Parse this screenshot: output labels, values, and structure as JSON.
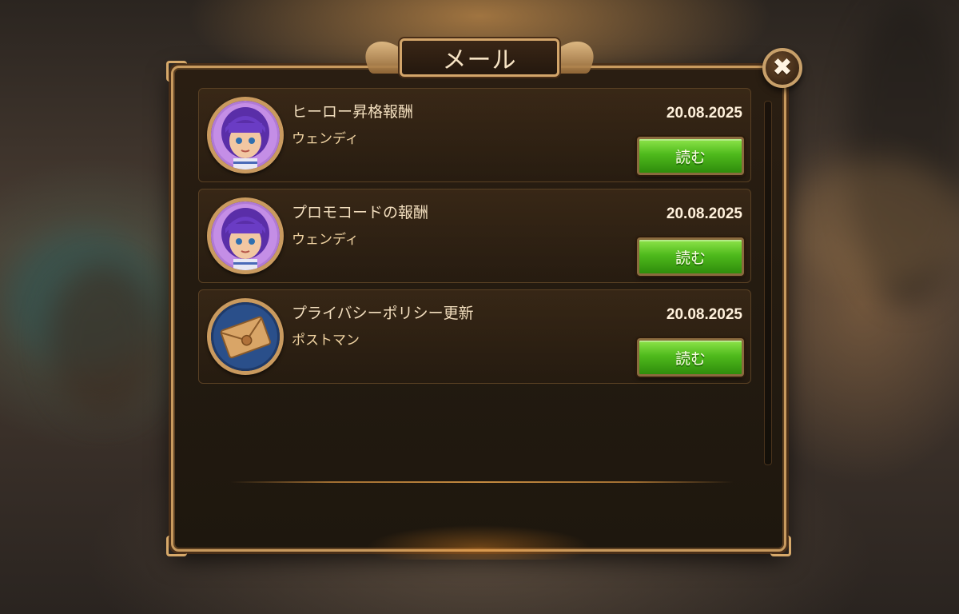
{
  "window": {
    "title": "メール",
    "close_icon": "close-icon"
  },
  "mails": [
    {
      "title": "ヒーロー昇格報酬",
      "sender": "ウェンディ",
      "date": "20.08.2025",
      "button_label": "読む",
      "icon": "hero-avatar-icon"
    },
    {
      "title": "プロモコードの報酬",
      "sender": "ウェンディ",
      "date": "20.08.2025",
      "button_label": "読む",
      "icon": "hero-avatar-icon"
    },
    {
      "title": "プライバシーポリシー更新",
      "sender": "ポストマン",
      "date": "20.08.2025",
      "button_label": "読む",
      "icon": "envelope-icon"
    }
  ],
  "colors": {
    "accent_gold": "#c89a5e",
    "button_green": "#4fba1c",
    "panel_dark": "#221a10"
  }
}
